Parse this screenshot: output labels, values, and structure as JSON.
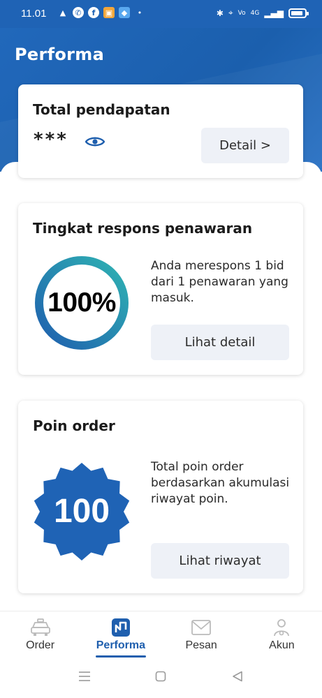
{
  "status_bar": {
    "time": "11.01",
    "network_label": "4G"
  },
  "header": {
    "title": "Performa"
  },
  "income_card": {
    "title": "Total pendapatan",
    "hidden_value": "***",
    "detail_button": "Detail >"
  },
  "response_card": {
    "title": "Tingkat respons penawaran",
    "rate": "100%",
    "rate_value": 100,
    "description": "Anda merespons 1 bid dari 1 penawaran yang masuk.",
    "button": "Lihat detail"
  },
  "points_card": {
    "title": "Poin order",
    "points": "100",
    "description": "Total poin order berdasarkan akumulasi riwayat poin.",
    "button": "Lihat riwayat"
  },
  "bottom_nav": {
    "items": [
      {
        "label": "Order",
        "icon": "car-icon"
      },
      {
        "label": "Performa",
        "icon": "performance-icon",
        "active": true
      },
      {
        "label": "Pesan",
        "icon": "mail-icon"
      },
      {
        "label": "Akun",
        "icon": "account-icon"
      }
    ]
  },
  "colors": {
    "brand_blue": "#1f63b5",
    "ring_start": "#1f5fae",
    "ring_end": "#2fb3b3",
    "badge_blue": "#1f63b5"
  }
}
